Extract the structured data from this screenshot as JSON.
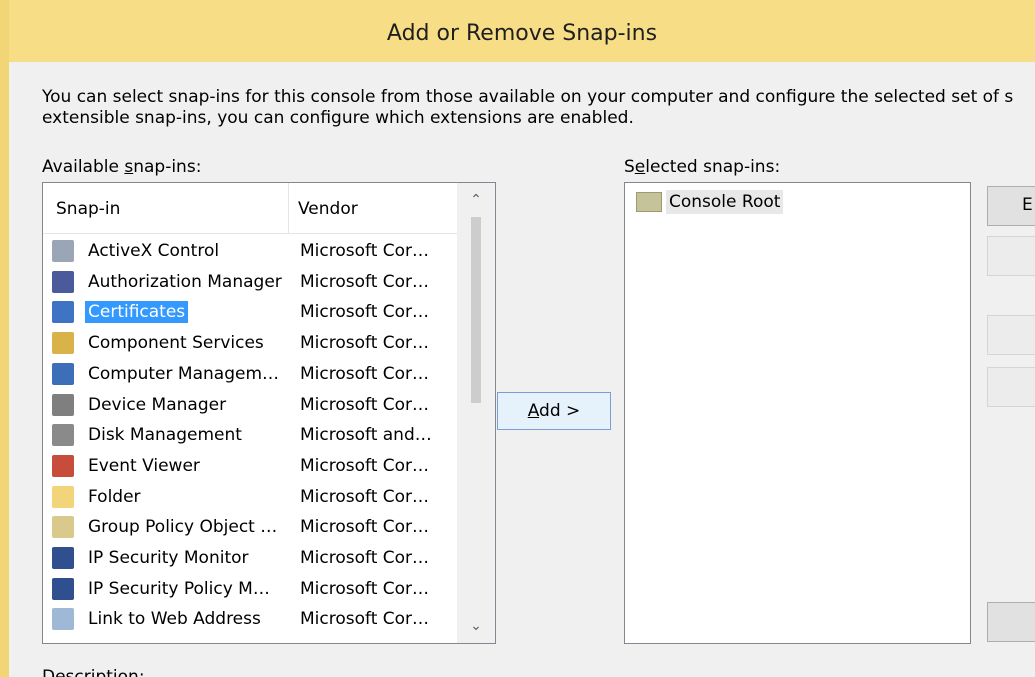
{
  "window": {
    "title": "Add or Remove Snap-ins"
  },
  "intro": {
    "line1": "You can select snap-ins for this console from those available on your computer and configure the selected set of s",
    "line2": "extensible snap-ins, you can configure which extensions are enabled."
  },
  "available": {
    "label_prefix": "Available ",
    "label_accel": "s",
    "label_rest": "nap-ins:",
    "columns": [
      "Snap-in",
      "Vendor"
    ],
    "items": [
      {
        "name": "ActiveX Control",
        "vendor": "Microsoft Cor…",
        "icon": "activex-icon",
        "color": "#9aa5b5"
      },
      {
        "name": "Authorization Manager",
        "vendor": "Microsoft Cor…",
        "icon": "authorization-icon",
        "color": "#4a5a9a"
      },
      {
        "name": "Certificates",
        "vendor": "Microsoft Cor…",
        "icon": "certificate-icon",
        "color": "#3f74c4",
        "selected": true
      },
      {
        "name": "Component Services",
        "vendor": "Microsoft Cor…",
        "icon": "component-services-icon",
        "color": "#d9b24a"
      },
      {
        "name": "Computer Managem…",
        "vendor": "Microsoft Cor…",
        "icon": "computer-management-icon",
        "color": "#3d6fb8"
      },
      {
        "name": "Device Manager",
        "vendor": "Microsoft Cor…",
        "icon": "device-manager-icon",
        "color": "#7f7f7f"
      },
      {
        "name": "Disk Management",
        "vendor": "Microsoft and…",
        "icon": "disk-management-icon",
        "color": "#8a8a8a"
      },
      {
        "name": "Event Viewer",
        "vendor": "Microsoft Cor…",
        "icon": "event-viewer-icon",
        "color": "#c84c3a"
      },
      {
        "name": "Folder",
        "vendor": "Microsoft Cor…",
        "icon": "folder-icon",
        "color": "#f2d47a"
      },
      {
        "name": "Group Policy Object …",
        "vendor": "Microsoft Cor…",
        "icon": "group-policy-icon",
        "color": "#d9c98c"
      },
      {
        "name": "IP Security Monitor",
        "vendor": "Microsoft Cor…",
        "icon": "ip-security-monitor-icon",
        "color": "#2f4f8f"
      },
      {
        "name": "IP Security Policy M…",
        "vendor": "Microsoft Cor…",
        "icon": "ip-security-policy-icon",
        "color": "#2f4f8f"
      },
      {
        "name": "Link to Web Address",
        "vendor": "Microsoft Cor…",
        "icon": "web-link-icon",
        "color": "#9fb8d6"
      }
    ]
  },
  "add_button": {
    "accel": "A",
    "rest": "dd >"
  },
  "selected": {
    "label_prefix": "S",
    "label_accel": "e",
    "label_rest": "lected snap-ins:",
    "items": [
      {
        "name": "Console Root",
        "icon": "console-root-icon"
      }
    ]
  },
  "right_buttons": {
    "edit_initial": "E"
  },
  "description_label": "Description:"
}
